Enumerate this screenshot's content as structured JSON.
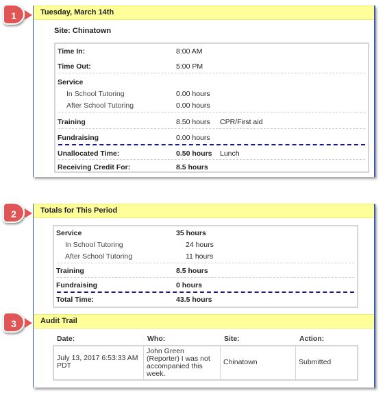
{
  "badges": [
    "1",
    "2",
    "3"
  ],
  "day": {
    "header": "Tuesday, March 14th",
    "site": "Site: Chinatown",
    "time_in_label": "Time In:",
    "time_in_value": "8:00 AM",
    "time_out_label": "Time Out:",
    "time_out_value": "5:00 PM",
    "service_label": "Service",
    "in_school_label": "In School Tutoring",
    "in_school_value": "0.00 hours",
    "after_school_label": "After School Tutoring",
    "after_school_value": "0.00 hours",
    "training_label": "Training",
    "training_value": "8.50 hours",
    "training_note": "CPR/First aid",
    "fundraising_label": "Fundraising",
    "fundraising_value": "0.00 hours",
    "unallocated_label": "Unallocated Time:",
    "unallocated_value": "0.50 hours",
    "unallocated_note": "Lunch",
    "credit_label": "Receiving Credit For:",
    "credit_value": "8.5 hours"
  },
  "totals": {
    "header": "Totals for This Period",
    "service_label": "Service",
    "service_value": "35 hours",
    "in_school_label": "In School Tutoring",
    "in_school_value": "24 hours",
    "after_school_label": "After School Tutoring",
    "after_school_value": "11 hours",
    "training_label": "Training",
    "training_value": "8.5 hours",
    "fundraising_label": "Fundraising",
    "fundraising_value": "0 hours",
    "total_label": "Total Time:",
    "total_value": "43.5 hours"
  },
  "audit": {
    "header": "Audit Trail",
    "columns": [
      "Date:",
      "Who:",
      "Site:",
      "Action:"
    ],
    "rows": [
      {
        "date": "July 13, 2017 6:53:33 AM PDT",
        "who": "John Green (Reporter) I was not accompanied this week.",
        "site": "Chinatown",
        "action": "Submitted"
      }
    ]
  }
}
